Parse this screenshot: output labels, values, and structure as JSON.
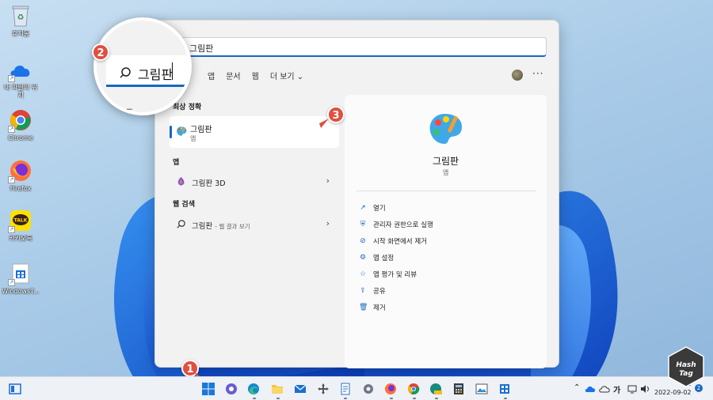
{
  "desktop": {
    "icons": [
      {
        "label": "휴지통",
        "icon": "recycle-bin-icon"
      },
      {
        "label": "내 파일의 위치",
        "icon": "onedrive-icon"
      },
      {
        "label": "Chrome",
        "icon": "chrome-icon"
      },
      {
        "label": "Firefox",
        "icon": "firefox-icon"
      },
      {
        "label": "카카오톡",
        "icon": "kakaotalk-icon"
      },
      {
        "label": "WindowsT...",
        "icon": "windows-terminal-icon"
      }
    ]
  },
  "search": {
    "query": "그림판",
    "filters": [
      "앱",
      "문서",
      "웹",
      "더 보기"
    ],
    "more_label": "···"
  },
  "results": {
    "best_match_header": "최상 정확",
    "best_match": {
      "name": "그림판",
      "type": "앱"
    },
    "apps_header": "앱",
    "apps": [
      {
        "name": "그림판 3D"
      }
    ],
    "web_header": "웹 검색",
    "web": [
      {
        "name": "그림판",
        "suffix": "- 웹 결과 보기"
      }
    ]
  },
  "detail": {
    "name": "그림판",
    "type": "앱",
    "actions": [
      {
        "label": "열기",
        "icon": "open-icon"
      },
      {
        "label": "관리자 권한으로 실행",
        "icon": "admin-shield-icon"
      },
      {
        "label": "시작 화면에서 제거",
        "icon": "unpin-icon"
      },
      {
        "label": "앱 설정",
        "icon": "gear-icon"
      },
      {
        "label": "앱 평가 및 리뷰",
        "icon": "star-icon"
      },
      {
        "label": "공유",
        "icon": "share-icon"
      },
      {
        "label": "제거",
        "icon": "trash-icon"
      }
    ]
  },
  "magnifier": {
    "text": "그림판",
    "below_text": "ㄷ"
  },
  "badges": {
    "one": "1",
    "two": "2",
    "three": "3"
  },
  "taskbar": {
    "ime": "가",
    "date": "2022-09-02",
    "time": "오",
    "notification_count": "2",
    "watermark_top": "Hash",
    "watermark_bottom": "Tag"
  },
  "colors": {
    "accent": "#1967c0",
    "badge": "#e0503f"
  }
}
